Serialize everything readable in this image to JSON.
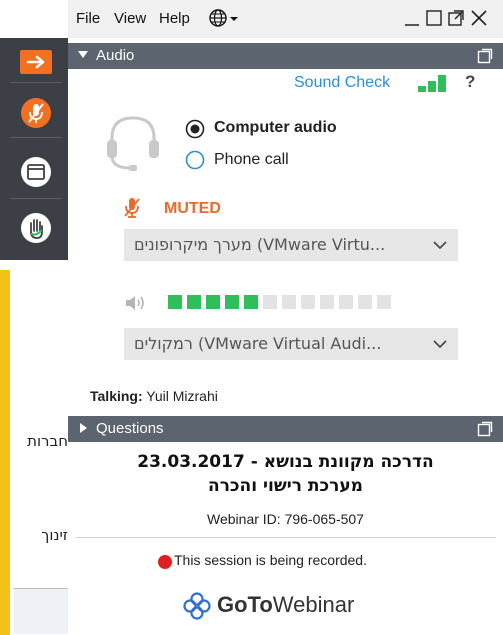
{
  "menu": {
    "file": "File",
    "view": "View",
    "help": "Help",
    "language_icon": "globe-icon"
  },
  "window_controls": [
    "minimize-icon",
    "restore-icon",
    "popout-icon",
    "close-icon"
  ],
  "sidebar": {
    "buttons": [
      "arrow-right-icon",
      "mic-muted-icon",
      "window-icon",
      "hand-raise-icon"
    ],
    "behind_text": [
      "חברות",
      "זינוך"
    ]
  },
  "audio": {
    "header": "Audio",
    "sound_check": "Sound Check",
    "help": "?",
    "options": [
      {
        "label": "Computer audio",
        "selected": true
      },
      {
        "label": "Phone call",
        "selected": false
      }
    ],
    "mic_status": "MUTED",
    "microphone": "מערך מיקרופונים (VMware Virtu...",
    "speaker": "רמקולים (VMware Virtual Audi...",
    "speaker_level": {
      "active": 5,
      "total": 12
    },
    "talking_label": "Talking:",
    "talking_name": "Yuil Mizrahi"
  },
  "questions": {
    "header": "Questions",
    "title_line1": "הדרכה מקוונת בנושא  - 23.03.2017",
    "title_line2": "מערכת רישוי והכרה",
    "webinar_id": "Webinar ID: 796-065-507",
    "recording": "This session is being recorded.",
    "logo_goto": "GoTo",
    "logo_webinar": "Webinar"
  },
  "colors": {
    "header_bg": "#5c6470",
    "sidebar_bg": "#3c3f45",
    "accent_orange": "#f36f21",
    "muted_orange": "#e86b2a",
    "link_blue": "#2b8fd6",
    "level_green": "#2fbf5a",
    "record_red": "#e02020"
  }
}
